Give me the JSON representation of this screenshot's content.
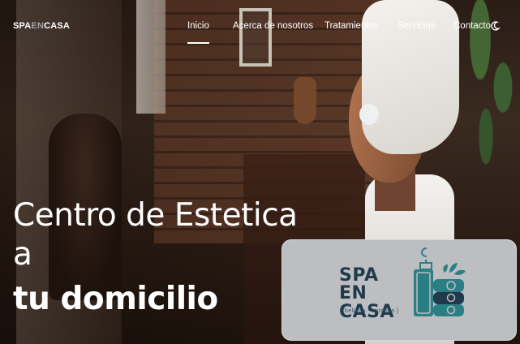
{
  "brand": {
    "part1": "SPA",
    "part2": "EN",
    "part3": "CASA"
  },
  "nav": {
    "items": [
      {
        "label": "Inicio",
        "active": true
      },
      {
        "label": "Acerca de nosotros",
        "active": false
      },
      {
        "label": "Tratamientos",
        "active": false
      },
      {
        "label": "Servicios",
        "active": false
      },
      {
        "label": "Contacto",
        "active": false
      }
    ],
    "theme_toggle_icon": "moon-icon"
  },
  "hero": {
    "line1": "Centro de Estetica a",
    "line2": "tu domicilio"
  },
  "logo": {
    "line1": "SPA EN",
    "line2": "CASA",
    "tagline": "[ belleza - estética ]",
    "text_color": "#1f3a4b",
    "mark_color": "#2a7f84",
    "card_bg": "#bcbec1"
  }
}
